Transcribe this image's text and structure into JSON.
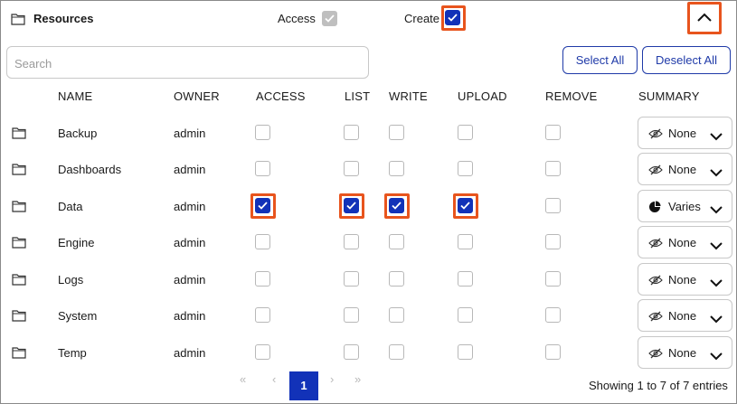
{
  "header": {
    "title": "Resources",
    "access_label": "Access",
    "create_label": "Create",
    "access_checked": true,
    "create_checked": true,
    "collapse_icon": "chevron-up-icon"
  },
  "search": {
    "placeholder": "Search"
  },
  "actions": {
    "select_all": "Select All",
    "deselect_all": "Deselect All"
  },
  "columns": [
    "NAME",
    "OWNER",
    "ACCESS",
    "LIST",
    "WRITE",
    "UPLOAD",
    "REMOVE",
    "SUMMARY"
  ],
  "rows": [
    {
      "name": "Backup",
      "owner": "admin",
      "access": false,
      "list": false,
      "write": false,
      "upload": false,
      "remove": false,
      "summary": "None",
      "summary_icon": "eye-slash-icon"
    },
    {
      "name": "Dashboards",
      "owner": "admin",
      "access": false,
      "list": false,
      "write": false,
      "upload": false,
      "remove": false,
      "summary": "None",
      "summary_icon": "eye-slash-icon"
    },
    {
      "name": "Data",
      "owner": "admin",
      "access": true,
      "list": true,
      "write": true,
      "upload": true,
      "remove": false,
      "summary": "Varies",
      "summary_icon": "pie-chart-icon"
    },
    {
      "name": "Engine",
      "owner": "admin",
      "access": false,
      "list": false,
      "write": false,
      "upload": false,
      "remove": false,
      "summary": "None",
      "summary_icon": "eye-slash-icon"
    },
    {
      "name": "Logs",
      "owner": "admin",
      "access": false,
      "list": false,
      "write": false,
      "upload": false,
      "remove": false,
      "summary": "None",
      "summary_icon": "eye-slash-icon"
    },
    {
      "name": "System",
      "owner": "admin",
      "access": false,
      "list": false,
      "write": false,
      "upload": false,
      "remove": false,
      "summary": "None",
      "summary_icon": "eye-slash-icon"
    },
    {
      "name": "Temp",
      "owner": "admin",
      "access": false,
      "list": false,
      "write": false,
      "upload": false,
      "remove": false,
      "summary": "None",
      "summary_icon": "eye-slash-icon"
    }
  ],
  "pagination": {
    "first": "«",
    "prev": "‹",
    "current": "1",
    "next": "›",
    "last": "»"
  },
  "footer": {
    "entries_text": "Showing 1 to 7 of 7 entries"
  },
  "colors": {
    "accent": "#1232b8",
    "highlight": "#e8541d",
    "border": "#c8c8c8"
  }
}
